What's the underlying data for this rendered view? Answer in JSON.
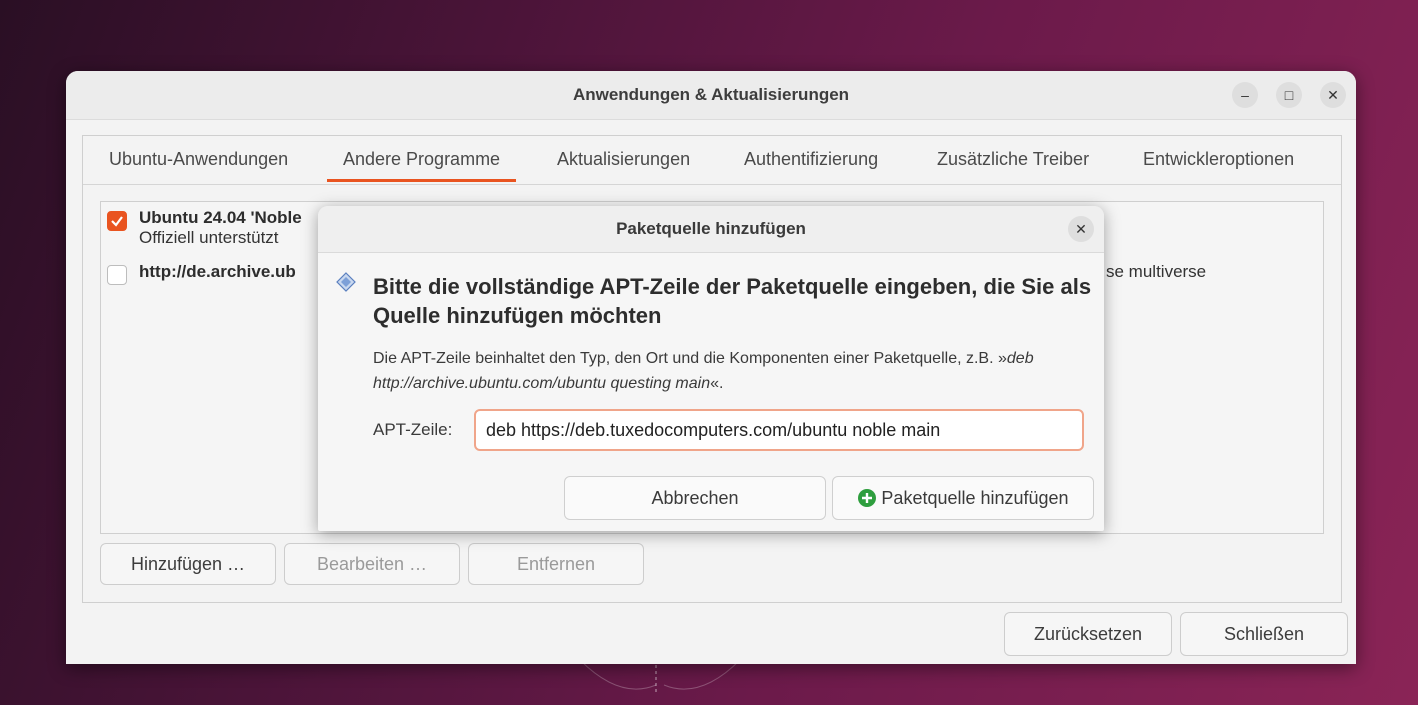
{
  "window": {
    "title": "Anwendungen & Aktualisierungen",
    "controls": {
      "minimize": "–",
      "maximize": "□",
      "close": "✕"
    }
  },
  "tabs": [
    {
      "label": "Ubuntu-Anwendungen"
    },
    {
      "label": "Andere Programme",
      "active": true
    },
    {
      "label": "Aktualisierungen"
    },
    {
      "label": "Authentifizierung"
    },
    {
      "label": "Zusätzliche Treiber"
    },
    {
      "label": "Entwickleroptionen"
    }
  ],
  "sources": [
    {
      "title": "Ubuntu 24.04 'Noble",
      "subtitle": "Offiziell unterstützt",
      "checked": true
    },
    {
      "title": "http://de.archive.ub",
      "trailing": "se multiverse",
      "checked": false
    }
  ],
  "source_buttons": {
    "add": "Hinzufügen …",
    "edit": "Bearbeiten …",
    "remove": "Entfernen"
  },
  "footer_buttons": {
    "reset": "Zurücksetzen",
    "close": "Schließen"
  },
  "dialog": {
    "title": "Paketquelle hinzufügen",
    "close": "✕",
    "heading": "Bitte die vollständige APT-Zeile der Paketquelle eingeben, die Sie als Quelle hinzufügen möchten",
    "explain_prefix": "Die APT-Zeile beinhaltet den Typ, den Ort und die Komponenten einer Paketquelle, z.B. »",
    "explain_example": "deb http://archive.ubuntu.com/ubuntu questing main",
    "explain_suffix": "«.",
    "apt_label": "APT-Zeile:",
    "apt_value": "deb https://deb.tuxedocomputers.com/ubuntu noble main",
    "cancel": "Abbrechen",
    "confirm": "Paketquelle hinzufügen"
  },
  "colors": {
    "accent": "#e95420",
    "add_icon": "#2e9e3e"
  }
}
